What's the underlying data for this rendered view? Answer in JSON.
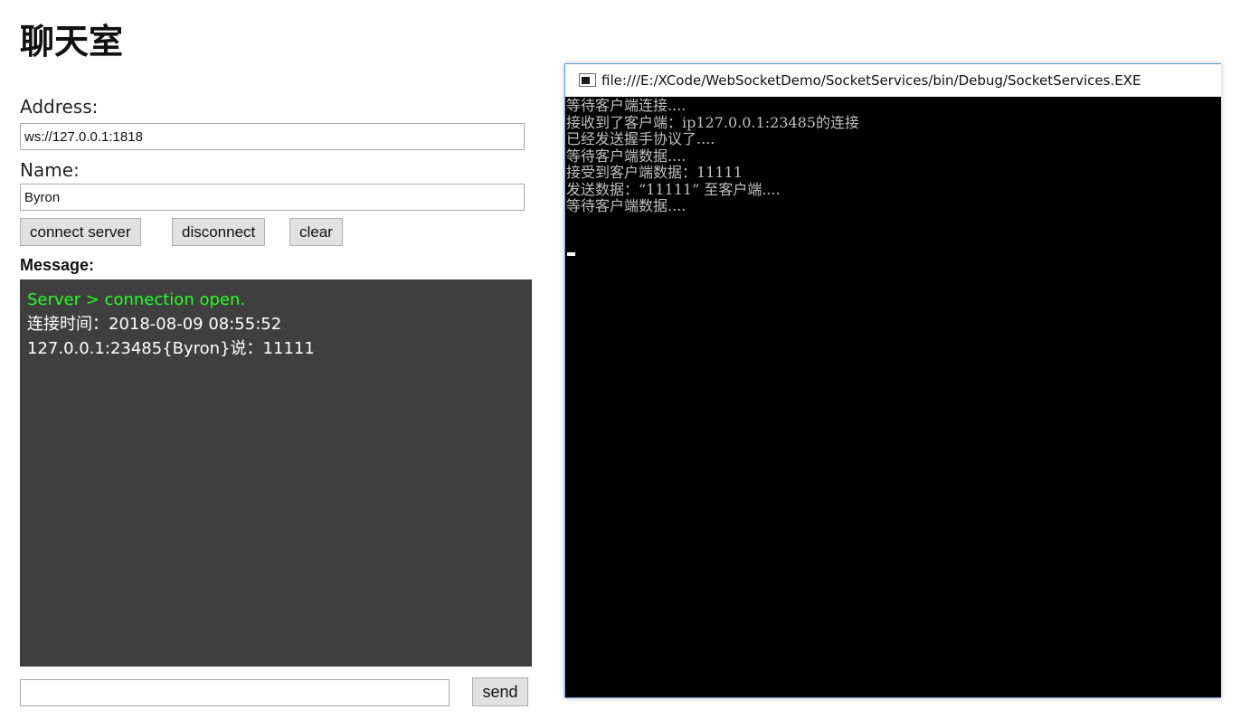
{
  "page": {
    "title": "聊天室"
  },
  "form": {
    "address_label": "Address:",
    "address_value": "ws://127.0.0.1:1818",
    "name_label": "Name:",
    "name_value": "Byron",
    "message_label": "Message:"
  },
  "buttons": {
    "connect": "connect server",
    "disconnect": "disconnect",
    "clear": "clear",
    "send": "send"
  },
  "messages": [
    {
      "text": "Server > connection open.",
      "type": "server"
    },
    {
      "text": "连接时间：2018-08-09 08:55:52",
      "type": "normal"
    },
    {
      "text": "127.0.0.1:23485{Byron}说：11111",
      "type": "normal"
    }
  ],
  "send_input": {
    "value": ""
  },
  "console": {
    "title": "file:///E:/XCode/WebSocketDemo/SocketServices/bin/Debug/SocketServices.EXE",
    "lines": [
      "等待客户端连接....",
      "接收到了客户端：ip127.0.0.1:23485的连接",
      "已经发送握手协议了....",
      "等待客户端数据....",
      "接受到客户端数据：11111",
      "发送数据：“11111” 至客户端....",
      "等待客户端数据...."
    ]
  },
  "colors": {
    "server_message": "#22ff22",
    "message_panel_bg": "#3f3f3f",
    "console_bg": "#000000",
    "console_text": "#c0c0c0"
  },
  "icons": {
    "console_app": "console-app-icon"
  }
}
